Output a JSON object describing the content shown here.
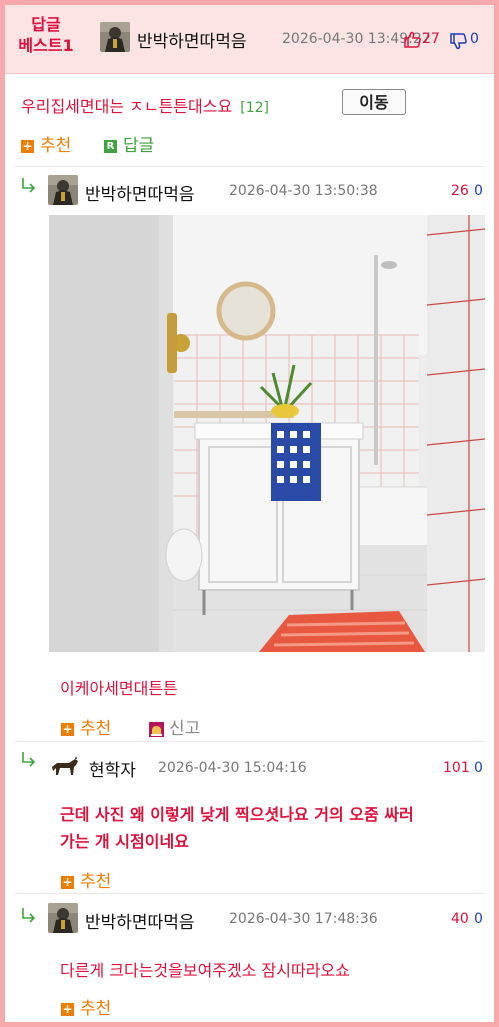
{
  "header": {
    "best_line1": "답글",
    "best_line2": "베스트1",
    "author": "반박하면따먹음",
    "datetime": "2026-04-30 13:49:27",
    "up_count": "27",
    "down_count": "0"
  },
  "post": {
    "title": "우리집세면대는 ㅈㄴ튼튼대스요",
    "comment_count": "[12]",
    "move_button": "이동",
    "recommend_label": "추천",
    "reply_label": "답글"
  },
  "comments": [
    {
      "author": "반박하면따먹음",
      "datetime": "2026-04-30 13:50:38",
      "up": "26",
      "down": "0",
      "text": "이케아세면대튼튼",
      "recommend_label": "추천",
      "report_label": "신고"
    },
    {
      "author": "현학자",
      "datetime": "2026-04-30 15:04:16",
      "up": "101",
      "down": "0",
      "text_line1": "근데 사진 왜 이렇게 낮게 찍으셧나요 거의 오줌 싸러",
      "text_line2": "가는 개 시점이네요",
      "recommend_label": "추천"
    },
    {
      "author": "반박하면따먹음",
      "datetime": "2026-04-30 17:48:36",
      "up": "40",
      "down": "0",
      "text": "다른게 크다는것을보여주겠소 잠시따라오쇼",
      "recommend_label": "추천"
    }
  ],
  "colors": {
    "accent_red": "#e0113c",
    "accent_orange": "#ef7d00",
    "green": "#3fa33f",
    "frame_pink": "#f8a9ac",
    "header_bg": "#fde4e4"
  }
}
